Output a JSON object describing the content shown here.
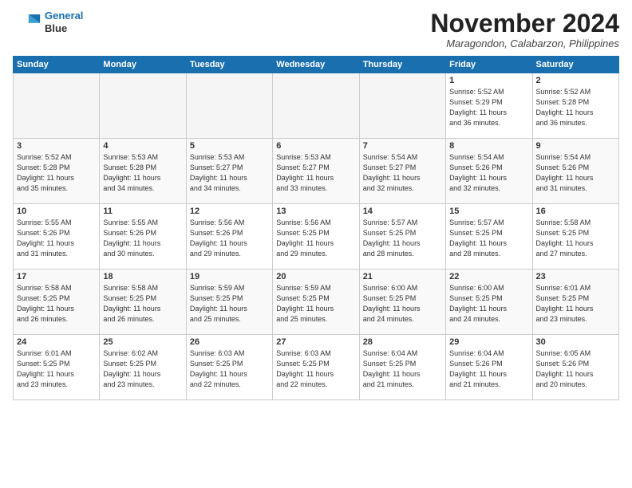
{
  "header": {
    "logo_line1": "General",
    "logo_line2": "Blue",
    "month": "November 2024",
    "location": "Maragondon, Calabarzon, Philippines"
  },
  "weekdays": [
    "Sunday",
    "Monday",
    "Tuesday",
    "Wednesday",
    "Thursday",
    "Friday",
    "Saturday"
  ],
  "weeks": [
    [
      {
        "day": "",
        "info": ""
      },
      {
        "day": "",
        "info": ""
      },
      {
        "day": "",
        "info": ""
      },
      {
        "day": "",
        "info": ""
      },
      {
        "day": "",
        "info": ""
      },
      {
        "day": "1",
        "info": "Sunrise: 5:52 AM\nSunset: 5:29 PM\nDaylight: 11 hours\nand 36 minutes."
      },
      {
        "day": "2",
        "info": "Sunrise: 5:52 AM\nSunset: 5:28 PM\nDaylight: 11 hours\nand 36 minutes."
      }
    ],
    [
      {
        "day": "3",
        "info": "Sunrise: 5:52 AM\nSunset: 5:28 PM\nDaylight: 11 hours\nand 35 minutes."
      },
      {
        "day": "4",
        "info": "Sunrise: 5:53 AM\nSunset: 5:28 PM\nDaylight: 11 hours\nand 34 minutes."
      },
      {
        "day": "5",
        "info": "Sunrise: 5:53 AM\nSunset: 5:27 PM\nDaylight: 11 hours\nand 34 minutes."
      },
      {
        "day": "6",
        "info": "Sunrise: 5:53 AM\nSunset: 5:27 PM\nDaylight: 11 hours\nand 33 minutes."
      },
      {
        "day": "7",
        "info": "Sunrise: 5:54 AM\nSunset: 5:27 PM\nDaylight: 11 hours\nand 32 minutes."
      },
      {
        "day": "8",
        "info": "Sunrise: 5:54 AM\nSunset: 5:26 PM\nDaylight: 11 hours\nand 32 minutes."
      },
      {
        "day": "9",
        "info": "Sunrise: 5:54 AM\nSunset: 5:26 PM\nDaylight: 11 hours\nand 31 minutes."
      }
    ],
    [
      {
        "day": "10",
        "info": "Sunrise: 5:55 AM\nSunset: 5:26 PM\nDaylight: 11 hours\nand 31 minutes."
      },
      {
        "day": "11",
        "info": "Sunrise: 5:55 AM\nSunset: 5:26 PM\nDaylight: 11 hours\nand 30 minutes."
      },
      {
        "day": "12",
        "info": "Sunrise: 5:56 AM\nSunset: 5:26 PM\nDaylight: 11 hours\nand 29 minutes."
      },
      {
        "day": "13",
        "info": "Sunrise: 5:56 AM\nSunset: 5:25 PM\nDaylight: 11 hours\nand 29 minutes."
      },
      {
        "day": "14",
        "info": "Sunrise: 5:57 AM\nSunset: 5:25 PM\nDaylight: 11 hours\nand 28 minutes."
      },
      {
        "day": "15",
        "info": "Sunrise: 5:57 AM\nSunset: 5:25 PM\nDaylight: 11 hours\nand 28 minutes."
      },
      {
        "day": "16",
        "info": "Sunrise: 5:58 AM\nSunset: 5:25 PM\nDaylight: 11 hours\nand 27 minutes."
      }
    ],
    [
      {
        "day": "17",
        "info": "Sunrise: 5:58 AM\nSunset: 5:25 PM\nDaylight: 11 hours\nand 26 minutes."
      },
      {
        "day": "18",
        "info": "Sunrise: 5:58 AM\nSunset: 5:25 PM\nDaylight: 11 hours\nand 26 minutes."
      },
      {
        "day": "19",
        "info": "Sunrise: 5:59 AM\nSunset: 5:25 PM\nDaylight: 11 hours\nand 25 minutes."
      },
      {
        "day": "20",
        "info": "Sunrise: 5:59 AM\nSunset: 5:25 PM\nDaylight: 11 hours\nand 25 minutes."
      },
      {
        "day": "21",
        "info": "Sunrise: 6:00 AM\nSunset: 5:25 PM\nDaylight: 11 hours\nand 24 minutes."
      },
      {
        "day": "22",
        "info": "Sunrise: 6:00 AM\nSunset: 5:25 PM\nDaylight: 11 hours\nand 24 minutes."
      },
      {
        "day": "23",
        "info": "Sunrise: 6:01 AM\nSunset: 5:25 PM\nDaylight: 11 hours\nand 23 minutes."
      }
    ],
    [
      {
        "day": "24",
        "info": "Sunrise: 6:01 AM\nSunset: 5:25 PM\nDaylight: 11 hours\nand 23 minutes."
      },
      {
        "day": "25",
        "info": "Sunrise: 6:02 AM\nSunset: 5:25 PM\nDaylight: 11 hours\nand 23 minutes."
      },
      {
        "day": "26",
        "info": "Sunrise: 6:03 AM\nSunset: 5:25 PM\nDaylight: 11 hours\nand 22 minutes."
      },
      {
        "day": "27",
        "info": "Sunrise: 6:03 AM\nSunset: 5:25 PM\nDaylight: 11 hours\nand 22 minutes."
      },
      {
        "day": "28",
        "info": "Sunrise: 6:04 AM\nSunset: 5:25 PM\nDaylight: 11 hours\nand 21 minutes."
      },
      {
        "day": "29",
        "info": "Sunrise: 6:04 AM\nSunset: 5:26 PM\nDaylight: 11 hours\nand 21 minutes."
      },
      {
        "day": "30",
        "info": "Sunrise: 6:05 AM\nSunset: 5:26 PM\nDaylight: 11 hours\nand 20 minutes."
      }
    ]
  ]
}
